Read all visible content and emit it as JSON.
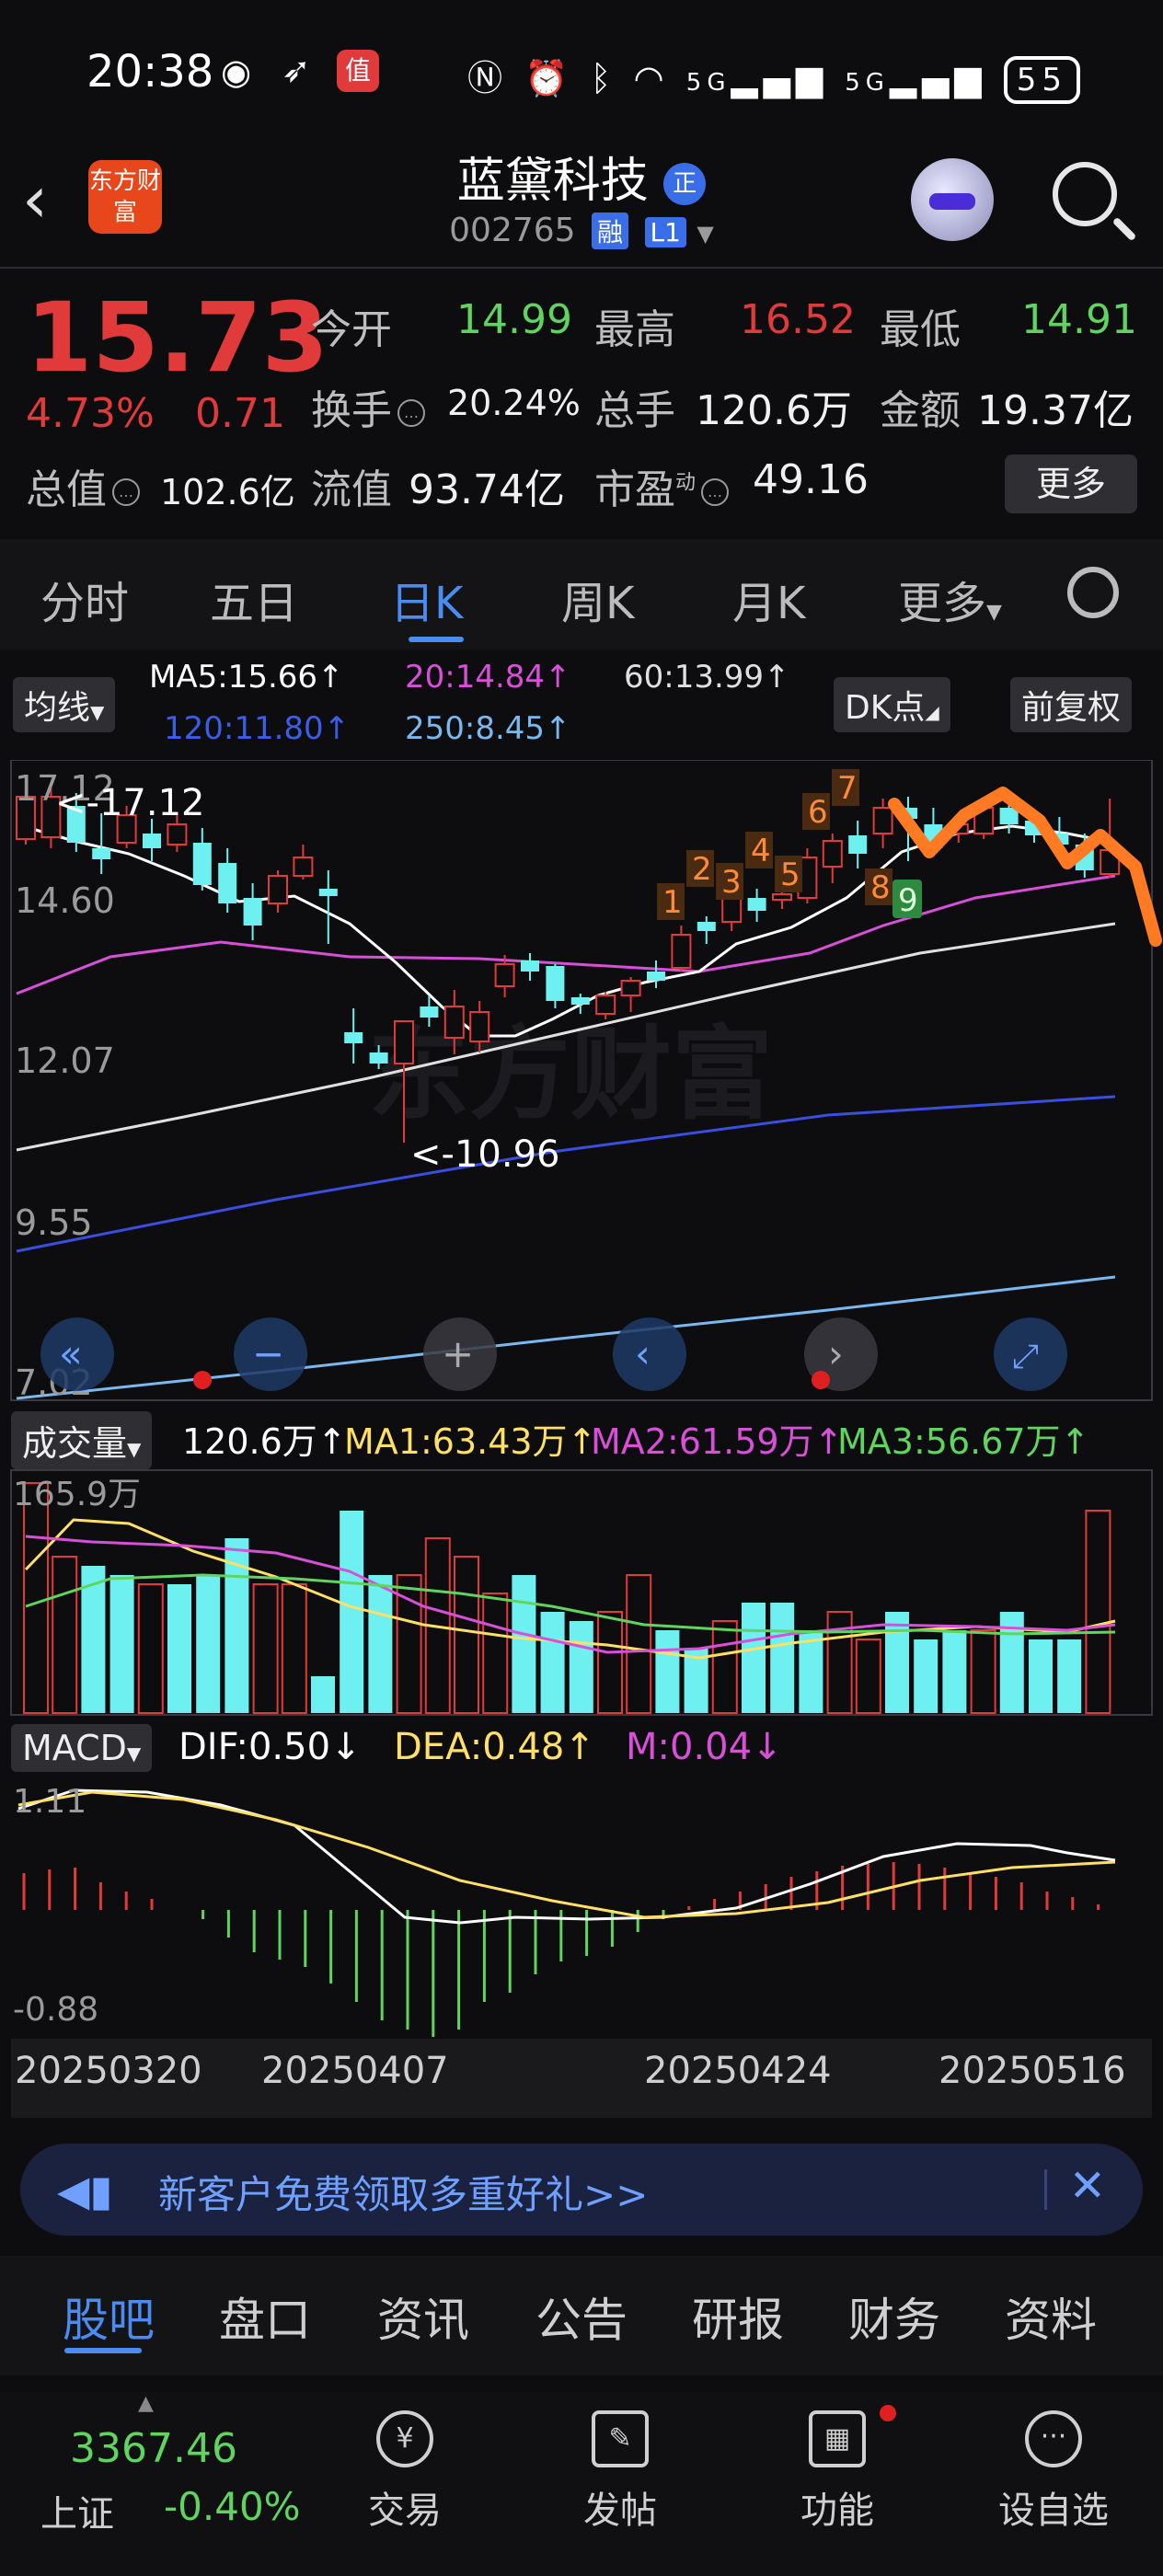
{
  "status_bar": {
    "time": "20:38",
    "battery": "55",
    "network": "5G"
  },
  "header": {
    "logo": "东方财富",
    "stock_name": "蓝黛科技",
    "name_badge": "正",
    "code": "002765",
    "tag_margin": "融",
    "tag_level": "L1"
  },
  "quote": {
    "price": "15.73",
    "change_pct": "4.73%",
    "change": "0.71",
    "open_label": "今开",
    "open": "14.99",
    "high_label": "最高",
    "high": "16.52",
    "low_label": "最低",
    "low": "14.91",
    "turnover_label": "换手",
    "turnover": "20.24%",
    "volume_label": "总手",
    "volume": "120.6万",
    "amount_label": "金额",
    "amount": "19.37亿",
    "mktcap_label": "总值",
    "mktcap": "102.6亿",
    "float_label": "流值",
    "float": "93.74亿",
    "pe_label": "市盈",
    "pe_sup": "动",
    "pe": "49.16",
    "more_label": "更多"
  },
  "tabs": [
    "分时",
    "五日",
    "日K",
    "周K",
    "月K",
    "更多"
  ],
  "active_tab": "日K",
  "ma_legend": {
    "selector": "均线",
    "ma5": "MA5:15.66↑",
    "ma20": "20:14.84↑",
    "ma60": "60:13.99↑",
    "ma120": "120:11.80↑",
    "ma250": "250:8.45↑",
    "dk_label": "DK点",
    "adjust_label": "前复权"
  },
  "colors": {
    "up": "#e03a3a",
    "down": "#6ff0f0",
    "ma5": "#ffffff",
    "ma20": "#d84fd8",
    "ma60": "#e0e0e0",
    "ma120": "#3a4ee0",
    "ma250": "#7ab8f0",
    "accent": "#4a8cf2"
  },
  "kline": {
    "y_ticks": [
      "17.12",
      "14.60",
      "12.07",
      "9.55",
      "7.02"
    ],
    "high_marker": "<-17.12",
    "low_marker": "<-10.96",
    "td_up": [
      "1",
      "2",
      "3",
      "4",
      "5",
      "6",
      "7",
      "8"
    ],
    "td_down": "9",
    "watermark": "东方财富"
  },
  "volume": {
    "selector": "成交量",
    "value": "120.6万↑",
    "ma1": "MA1:63.43万↑",
    "ma2": "MA2:61.59万↑",
    "ma3": "MA3:56.67万↑",
    "top_tick": "165.9万"
  },
  "macd": {
    "selector": "MACD",
    "dif": "DIF:0.50↓",
    "dea": "DEA:0.48↑",
    "m": "M:0.04↓",
    "top_tick": "1.11",
    "bottom_tick": "-0.88"
  },
  "dates": [
    "20250320",
    "20250407",
    "20250424",
    "20250516"
  ],
  "banner": {
    "text": "新客户免费领取多重好礼>>"
  },
  "bottom_tabs": [
    "股吧",
    "盘口",
    "资讯",
    "公告",
    "研报",
    "财务",
    "资料"
  ],
  "active_bottom_tab": "股吧",
  "footer": {
    "index_value": "3367.46",
    "index_name": "上证",
    "index_change": "-0.40%",
    "items": [
      "交易",
      "发帖",
      "功能",
      "设自选"
    ]
  }
}
